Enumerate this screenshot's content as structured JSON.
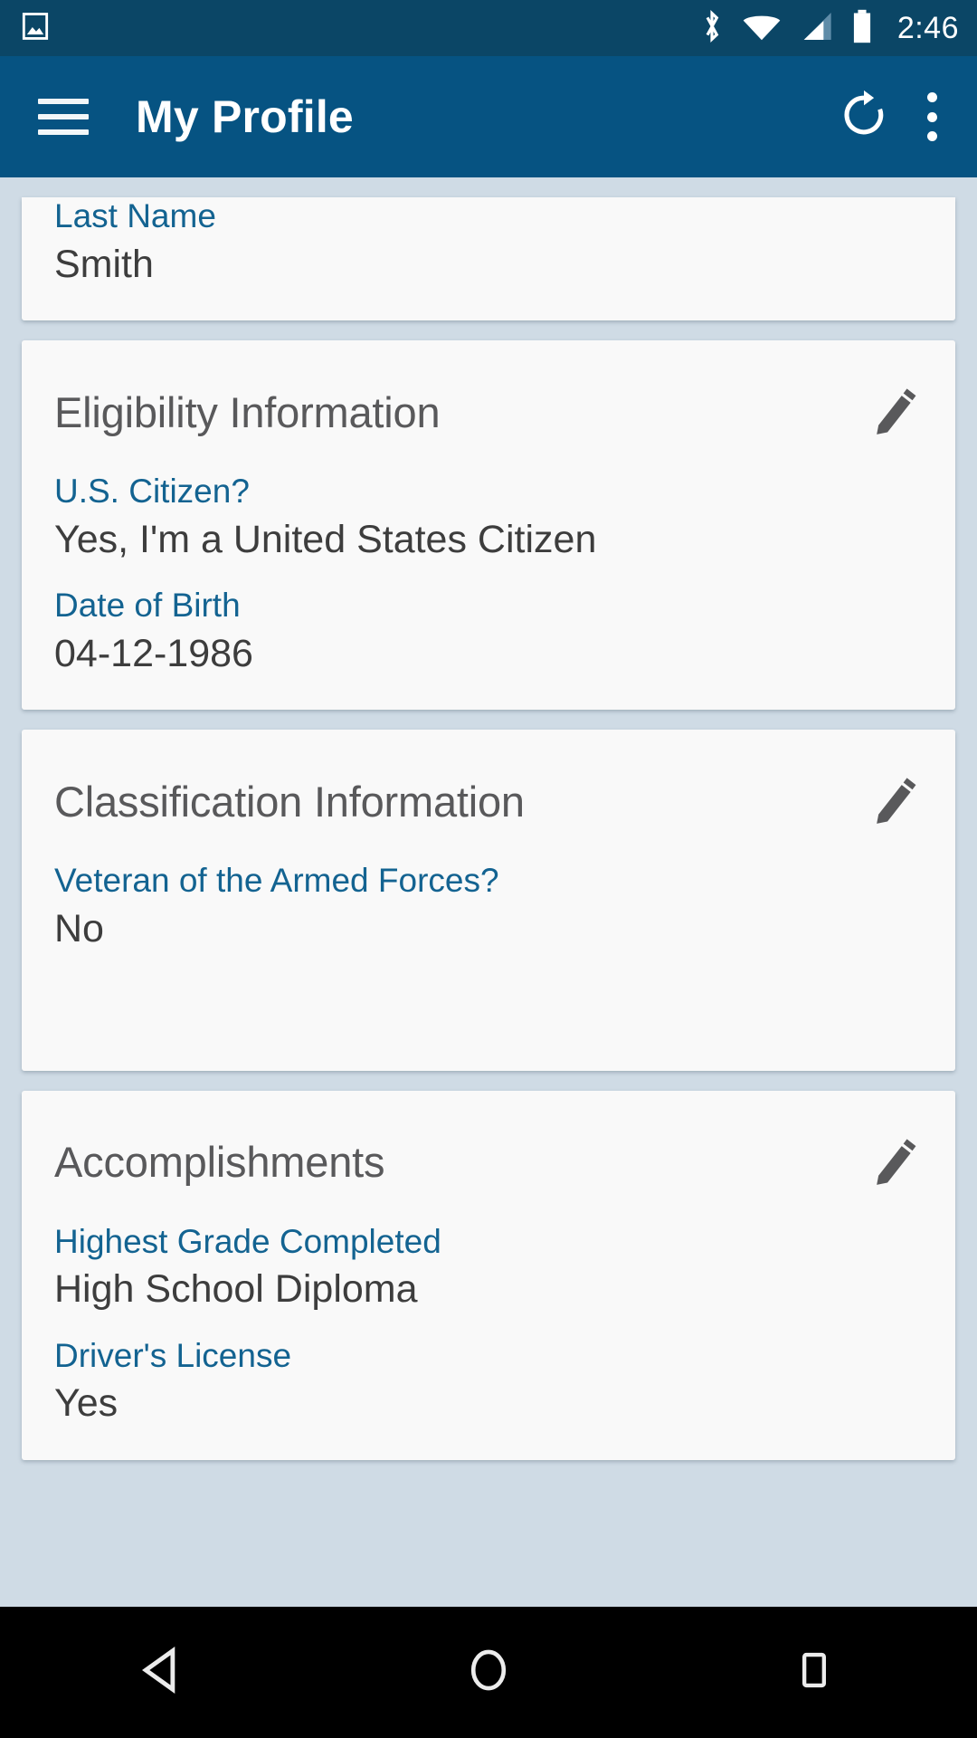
{
  "status_bar": {
    "background": "#0b4666",
    "clock": "2:46",
    "icons": [
      "photo-icon",
      "bluetooth-icon",
      "wifi-icon",
      "cellular-signal-icon",
      "battery-icon"
    ]
  },
  "app_bar": {
    "background": "#065382",
    "title": "My Profile",
    "menu_icon": "hamburger-menu-icon",
    "refresh_icon": "refresh-icon",
    "overflow_icon": "more-vertical-icon"
  },
  "theme": {
    "page_background": "#cfdbe5",
    "card_background": "#f9f9f9",
    "label_color": "#136391",
    "value_color": "#3d3d3d",
    "heading_color": "#59595b"
  },
  "cards": [
    {
      "title": "",
      "has_edit": false,
      "fields": [
        {
          "label": "Last Name",
          "value": "Smith"
        }
      ]
    },
    {
      "title": "Eligibility Information",
      "has_edit": true,
      "edit_icon": "pencil-edit-icon",
      "fields": [
        {
          "label": "U.S. Citizen?",
          "value": "Yes, I'm a United States Citizen"
        },
        {
          "label": "Date of Birth",
          "value": "04-12-1986"
        }
      ]
    },
    {
      "title": "Classification Information",
      "has_edit": true,
      "edit_icon": "pencil-edit-icon",
      "fields": [
        {
          "label": "Veteran of the Armed Forces?",
          "value": "No"
        }
      ]
    },
    {
      "title": "Accomplishments",
      "has_edit": true,
      "edit_icon": "pencil-edit-icon",
      "fields": [
        {
          "label": "Highest Grade Completed",
          "value": "High School Diploma"
        },
        {
          "label": "Driver's License",
          "value": "Yes"
        }
      ]
    }
  ],
  "nav_bar": {
    "background": "#000000",
    "buttons": [
      {
        "name": "back-button",
        "icon": "triangle-back-icon"
      },
      {
        "name": "home-button",
        "icon": "circle-home-icon"
      },
      {
        "name": "recents-button",
        "icon": "square-recents-icon"
      }
    ]
  }
}
